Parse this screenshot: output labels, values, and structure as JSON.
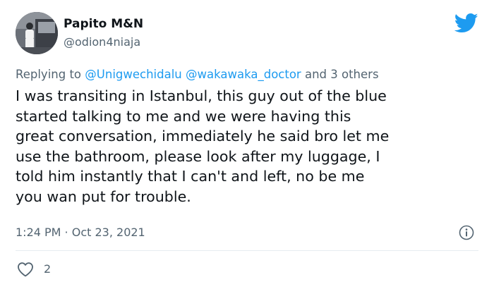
{
  "author": {
    "display_name": "Papito M&N",
    "handle": "@odion4niaja"
  },
  "reply": {
    "prefix": "Replying to ",
    "mention_1": "@Unigwechidalu",
    "mention_2": "@wakawaka_doctor",
    "suffix": " and 3 others"
  },
  "tweet": {
    "text": "I was transiting in Istanbul, this guy out of the blue\nstarted talking to me and we were having this\ngreat conversation, immediately he said bro let me\nuse the bathroom, please look after my luggage, I\ntold him instantly that I can't and left, no be me\nyou wan put for trouble.",
    "timestamp": "1:24 PM · Oct 23, 2021"
  },
  "actions": {
    "like_count": "2"
  },
  "icons": {
    "brand": "twitter-bird-icon",
    "info": "info-icon",
    "like": "heart-icon"
  },
  "colors": {
    "brand": "#1d9bf0",
    "mention": "#1d9bf0",
    "secondary_text": "#536471",
    "primary_text": "#0f1419"
  }
}
